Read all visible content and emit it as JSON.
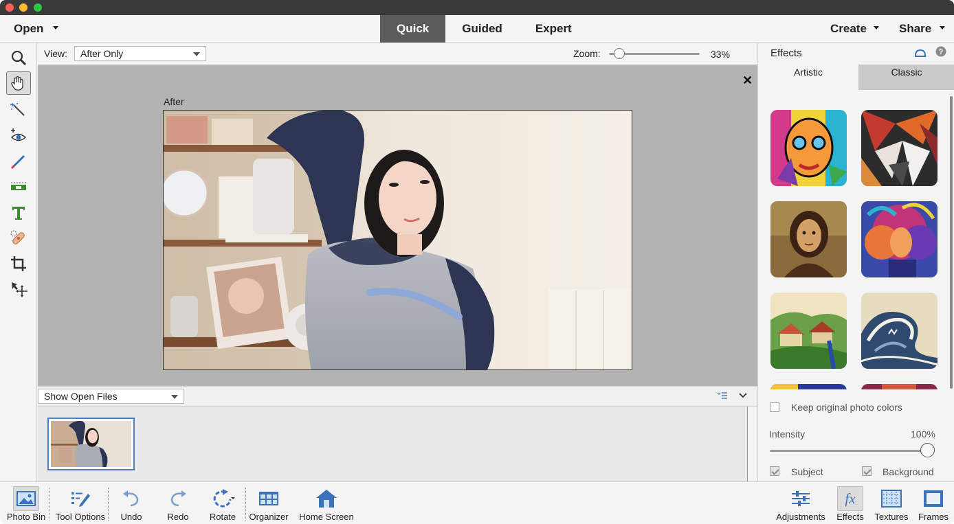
{
  "modebar": {
    "open_label": "Open",
    "tabs": [
      "Quick",
      "Guided",
      "Expert"
    ],
    "active_tab": "Quick",
    "create_label": "Create",
    "share_label": "Share"
  },
  "options": {
    "view_label": "View:",
    "view_value": "After Only",
    "zoom_label": "Zoom:",
    "zoom_value": "33%",
    "zoom_fraction": 0.33
  },
  "canvas": {
    "caption": "After"
  },
  "bin": {
    "source_value": "Show Open Files"
  },
  "effects_panel": {
    "title": "Effects",
    "tabs": [
      "Artistic",
      "Classic"
    ],
    "active_tab": "Artistic",
    "keep_colors_label": "Keep original photo colors",
    "intensity_label": "Intensity",
    "intensity_value": "100%",
    "subject_label": "Subject",
    "background_label": "Background"
  },
  "bottom": {
    "photo_bin": "Photo Bin",
    "tool_options": "Tool Options",
    "undo": "Undo",
    "redo": "Redo",
    "rotate": "Rotate",
    "organizer": "Organizer",
    "home_screen": "Home Screen",
    "adjustments": "Adjustments",
    "effects": "Effects",
    "textures": "Textures",
    "frames": "Frames"
  },
  "colors": {
    "active_mode_tab": "#5b5b5b",
    "thumb_border": "#4a7fc4",
    "icon_blue": "#3b73b9",
    "icon_green": "#3b8a2f"
  }
}
